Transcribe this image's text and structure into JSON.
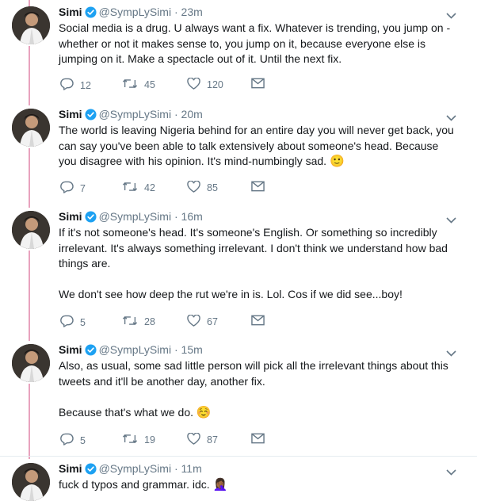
{
  "thread_color": "#e8a2bd",
  "tweets": [
    {
      "name": "Simi",
      "handle": "@SympLySimi",
      "separator": "·",
      "time": "23m",
      "paragraphs": [
        "Social media is a drug. U always want a fix. Whatever is trending, you jump on - whether or not it makes sense to, you jump on it, because everyone else is jumping on it. Make a spectacle out of it. Until the next fix."
      ],
      "replies": "12",
      "retweets": "45",
      "likes": "120"
    },
    {
      "name": "Simi",
      "handle": "@SympLySimi",
      "separator": "·",
      "time": "20m",
      "paragraphs": [
        "The world is leaving Nigeria behind for an entire day you will never get back, you can say you've been able to talk extensively about someone's head. Because you disagree with his opinion. It's mind-numbingly sad."
      ],
      "emoji": "🙂",
      "replies": "7",
      "retweets": "42",
      "likes": "85"
    },
    {
      "name": "Simi",
      "handle": "@SympLySimi",
      "separator": "·",
      "time": "16m",
      "paragraphs": [
        "If it's not someone's head. It's someone's English. Or something so incredibly irrelevant. It's always something irrelevant. I don't think we understand how bad things are.",
        "We don't see how deep the rut we're in is. Lol. Cos if we did see...boy!"
      ],
      "replies": "5",
      "retweets": "28",
      "likes": "67"
    },
    {
      "name": "Simi",
      "handle": "@SympLySimi",
      "separator": "·",
      "time": "15m",
      "paragraphs": [
        "Also, as usual, some sad little person will pick all the irrelevant things about this tweets and it'll be another day, another fix.",
        "Because that's what we do."
      ],
      "emoji": "☺️",
      "replies": "5",
      "retweets": "19",
      "likes": "87"
    },
    {
      "name": "Simi",
      "handle": "@SympLySimi",
      "separator": "·",
      "time": "11m",
      "paragraphs": [
        "fuck d typos and grammar. idc."
      ],
      "emoji": "🤦🏾‍♀️"
    }
  ],
  "icons": {
    "reply": "reply-icon",
    "retweet": "retweet-icon",
    "like": "heart-icon",
    "dm": "envelope-icon",
    "menu": "chevron-down-icon",
    "verified": "verified-badge-icon"
  },
  "colors": {
    "text": "#14171a",
    "secondary": "#657786",
    "verified": "#1da1f2",
    "border": "#e6ecf0"
  }
}
